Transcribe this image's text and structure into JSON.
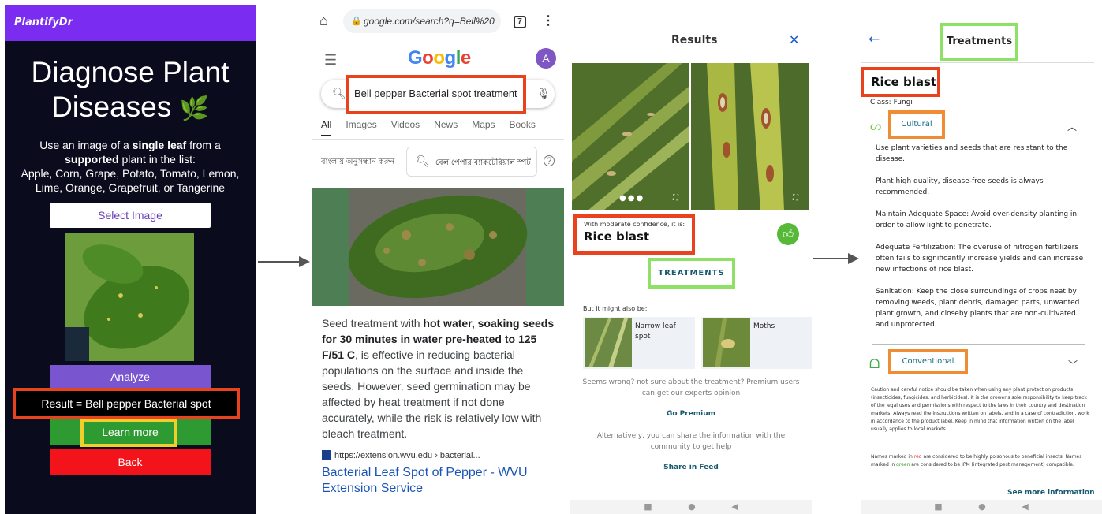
{
  "panel1": {
    "app_name": "PlantifyDr",
    "title_line1": "Diagnose Plant",
    "title_line2": "Diseases",
    "intro_pre": "Use an image of a ",
    "intro_bold1": "single leaf",
    "intro_mid": " from a ",
    "intro_bold2": "supported",
    "intro_post": " plant in the list:",
    "plant_list": "Apple, Corn, Grape, Potato, Tomato, Lemon, Lime, Orange, Grapefruit, or Tangerine",
    "select_image_label": "Select Image",
    "analyze_label": "Analyze",
    "result_text": "Result = Bell pepper Bacterial spot",
    "learn_more_label": "Learn more",
    "back_label": "Back"
  },
  "panel2": {
    "url": "google.com/search?q=Bell%20",
    "tab_count": "7",
    "logo": [
      "G",
      "o",
      "o",
      "g",
      "l",
      "e"
    ],
    "logo_colors": [
      "#4285f4",
      "#ea4335",
      "#fbbc05",
      "#4285f4",
      "#34a853",
      "#ea4335"
    ],
    "avatar_letter": "A",
    "query": "Bell pepper Bacterial spot treatment",
    "tabs": [
      "All",
      "Images",
      "Videos",
      "News",
      "Maps",
      "Books"
    ],
    "bengali_label": "বাংলায় অনুসন্ধান করুন",
    "bengali_query": "বেল পেপার ব্যাকটেরিয়াল স্পট",
    "snippet_pre": "Seed treatment with ",
    "snippet_bold": "hot water, soaking seeds for 30 minutes in water pre-heated to 125 F/51 C",
    "snippet_post": ", is effective in reducing bacterial populations on the surface and inside the seeds. However, seed germination may be affected by heat treatment if not done accurately, while the risk is relatively low with bleach treatment.",
    "cite": "https://extension.wvu.edu › bacterial...",
    "result_link": "Bacterial Leaf Spot of Pepper - WVU Extension Service"
  },
  "panel3": {
    "header": "Results",
    "confidence_text": "With moderate confidence, it is:",
    "diagnosis": "Rice blast",
    "treatments_label": "TREATMENTS",
    "maybe_label": "But it might also be:",
    "alt1": "Narrow leaf spot",
    "alt2": "Moths",
    "wrong_text": "Seems wrong? not sure about the treatment? Premium users can get our experts opinion",
    "go_premium": "Go Premium",
    "share_text": "Alternatively, you can share the information with the community to get help",
    "share_feed": "Share in Feed"
  },
  "panel4": {
    "header": "Treatments",
    "disease": "Rice blast",
    "class_text": "Class: Fungi",
    "cultural_label": "Cultural",
    "cultural_items": [
      "Use plant varieties and seeds that are resistant to the disease.",
      "Plant high quality, disease-free seeds is always recommended.",
      "Maintain Adequate Space:  Avoid over-density planting in order to allow light to penetrate.",
      "Adequate Fertilization:  The overuse of nitrogen fertilizers often fails to significantly increase yields and can increase new infections of rice blast.",
      "Sanitation: Keep the close surroundings of crops neat by removing weeds, plant debris, damaged parts, unwanted plant growth, and closeby plants that are non-cultivated and unprotected."
    ],
    "conventional_label": "Conventional",
    "fine_print": "Caution and careful notice should be taken when using any plant protection products (insecticides, fungicides, and herbicides). It is the grower's sole responsibility to keep track of the legal uses and permissions with respect to the laws in their country and destination markets. Always read the instructions written on labels, and in a case of contradiction, work in accordance to the product label. Keep in mind that information written on the label usually applies to local markets.",
    "fine_pre": "Names marked in ",
    "fine_red": "red",
    "fine_mid": " are considered to be highly poisonous to beneficial insects. Names marked in ",
    "fine_green": "green",
    "fine_post": " are considered to be IPM (integrated pest management) compatible.",
    "more_info": "See more information"
  }
}
